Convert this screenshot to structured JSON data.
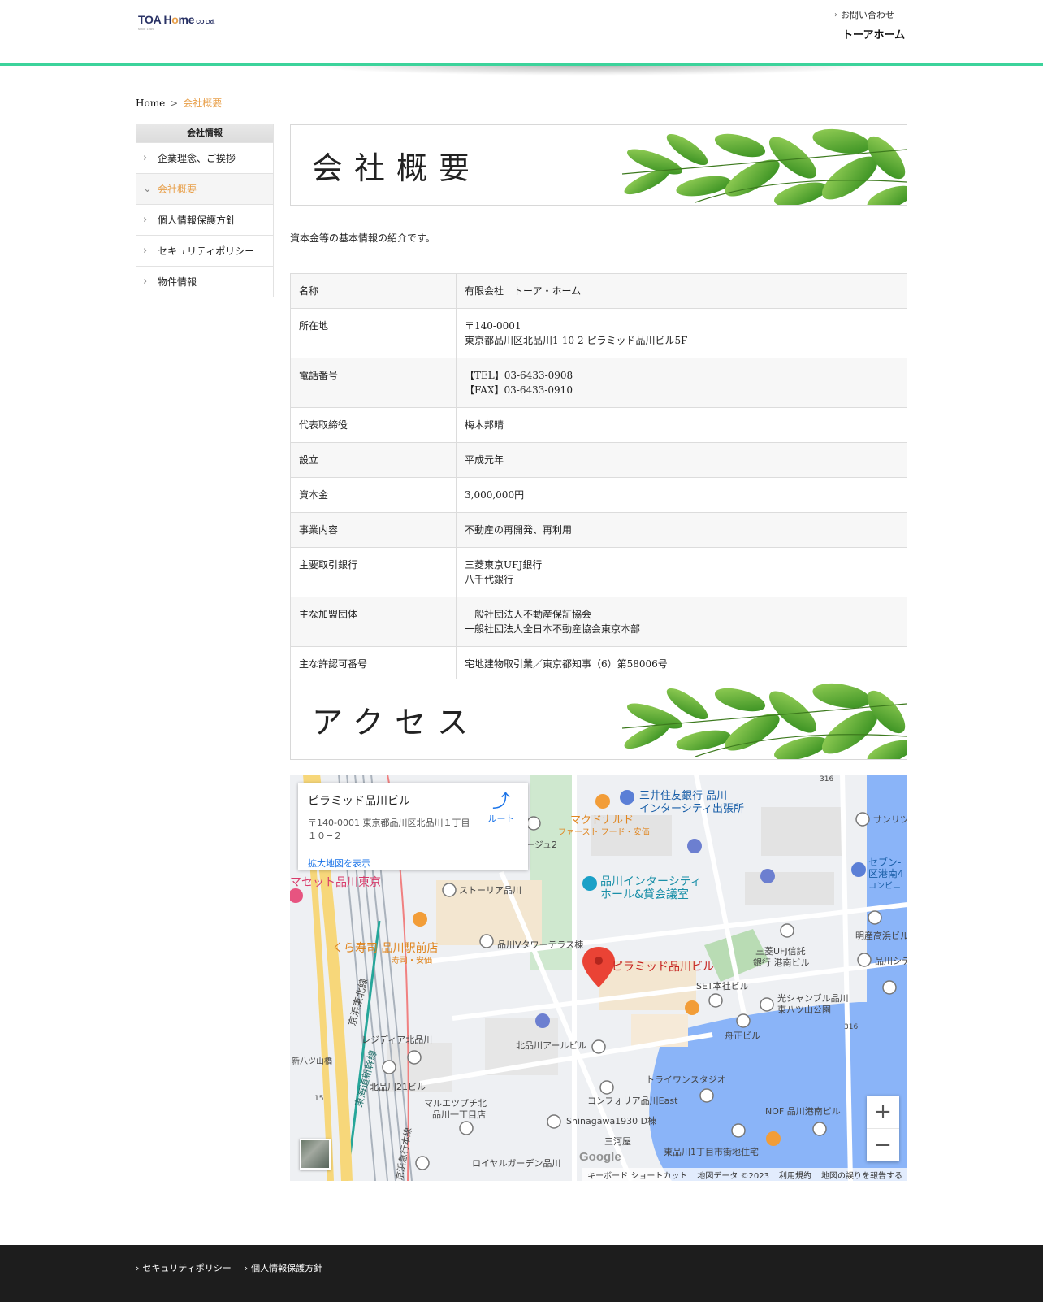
{
  "header": {
    "logo_main": "TOA H",
    "logo_o": "o",
    "logo_rest": "me",
    "logo_co": "CO Ltd.",
    "logo_sub": "since 1989",
    "contact_label": "お問い合わせ",
    "brand_name": "トーアホーム"
  },
  "breadcrumb": {
    "home": "Home",
    "separator": ">",
    "current": "会社概要"
  },
  "sidebar": {
    "heading": "会社情報",
    "items": [
      {
        "label": "企業理念、ご挨拶",
        "active": false
      },
      {
        "label": "会社概要",
        "active": true
      },
      {
        "label": "個人情報保護方針",
        "active": false
      },
      {
        "label": "セキュリティポリシー",
        "active": false
      },
      {
        "label": "物件情報",
        "active": false
      }
    ]
  },
  "main": {
    "title": "会社概要",
    "intro": "資本金等の基本情報の紹介です。",
    "access_title": "アクセス"
  },
  "company_table": [
    {
      "key": "名称",
      "lines": [
        "有限会社　トーア・ホーム"
      ]
    },
    {
      "key": "所在地",
      "lines": [
        "〒140-0001",
        "東京都品川区北品川1-10-2 ピラミッド品川ビル5F"
      ]
    },
    {
      "key": "電話番号",
      "lines": [
        "【TEL】03-6433-0908",
        "【FAX】03-6433-0910"
      ]
    },
    {
      "key": "代表取締役",
      "lines": [
        "梅木邦晴"
      ]
    },
    {
      "key": "設立",
      "lines": [
        "平成元年"
      ]
    },
    {
      "key": "資本金",
      "lines": [
        "3,000,000円"
      ]
    },
    {
      "key": "事業内容",
      "lines": [
        "不動産の再開発、再利用"
      ]
    },
    {
      "key": "主要取引銀行",
      "lines": [
        "三菱東京UFJ銀行",
        "八千代銀行"
      ]
    },
    {
      "key": "主な加盟団体",
      "lines": [
        "一般社団法人不動産保証協会",
        "一般社団法人全日本不動産協会東京本部"
      ]
    },
    {
      "key": "主な許認可番号",
      "lines": [
        "宅地建物取引業／東京都知事（6）第58006号"
      ]
    }
  ],
  "map": {
    "place_name": "ピラミッド品川ビル",
    "address": "〒140-0001 東京都品川区北品川１丁目１０−２",
    "route_label": "ルート",
    "enlarge_label": "拡大地図を表示",
    "zoom_in": "+",
    "zoom_out": "−",
    "google_logo": "Google",
    "footer_items": [
      "キーボード ショートカット",
      "地図データ ©2023",
      "利用規約",
      "地図の誤りを報告する"
    ],
    "labels": [
      "三井住友銀行 品川",
      "インターシティ出張所",
      "マクドナルド",
      "ファースト フード・安価",
      "サンリツ",
      "セブン-",
      "区港南4",
      "コンビニ",
      "品川インターシティ",
      "ホール&貸会議室",
      "マセット品川東京",
      "ストーリア品川",
      "くら寿司 品川駅前店",
      "寿司・安価",
      "品川Vタワーテラス棟",
      "ピラミッド品川ビル",
      "三菱UFJ信託",
      "銀行 港南ビル",
      "明産高浜ビル",
      "品川シテ",
      "SET本社ビル",
      "光シャンブル品川",
      "東八ツ山公園",
      "舟正ビル",
      "北品川アールビル",
      "レジディア北品川",
      "新八ツ山橋",
      "北品川21ビル",
      "マルエツプチ北",
      "品川一丁目店",
      "トライワンスタジオ",
      "コンフォリア品川East",
      "NOF 品川港南ビル",
      "Shinagawa1930 D棟",
      "三河屋",
      "東品川1丁目市街地住宅",
      "ロイヤルガーデン品川",
      "京浜東北線",
      "東海道新幹線",
      "京浜急行本線",
      "ージュ2",
      "316",
      "15"
    ]
  },
  "footer": {
    "links": [
      "セキュリティポリシー",
      "個人情報保護方針"
    ]
  },
  "colors": {
    "accent_green": "#3cd39b",
    "active_orange": "#e8a04b",
    "footer_bg": "#1d1d1d",
    "map_water": "#8ab4f8",
    "map_pin": "#ea4335",
    "map_link": "#1a73e8"
  }
}
